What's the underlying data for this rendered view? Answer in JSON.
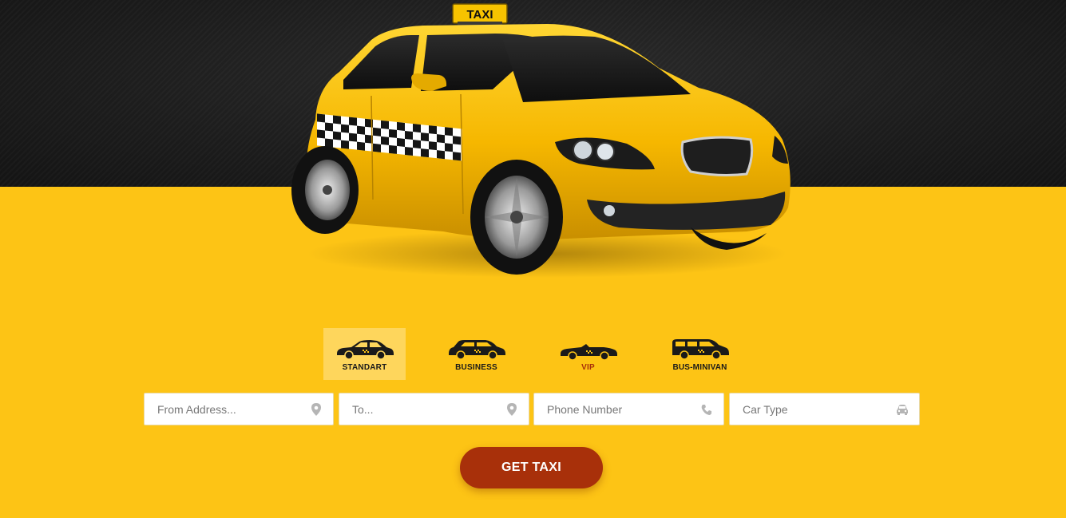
{
  "hero": {
    "roof_sign_text": "TAXI"
  },
  "car_types": [
    {
      "label": "STANDART",
      "active": true,
      "icon": "sedan-icon"
    },
    {
      "label": "BUSINESS",
      "active": false,
      "icon": "wagon-icon"
    },
    {
      "label": "VIP",
      "active": false,
      "icon": "convertible-icon"
    },
    {
      "label": "BUS-MINIVAN",
      "active": false,
      "icon": "minivan-icon"
    }
  ],
  "form": {
    "from_placeholder": "From Address...",
    "to_placeholder": "To...",
    "phone_placeholder": "Phone Number",
    "car_type_placeholder": "Car Type",
    "submit_label": "GET TAXI"
  },
  "colors": {
    "accent_yellow": "#fdc415",
    "button_brown": "#a8300a",
    "dark_bg": "#1c1c1c"
  }
}
